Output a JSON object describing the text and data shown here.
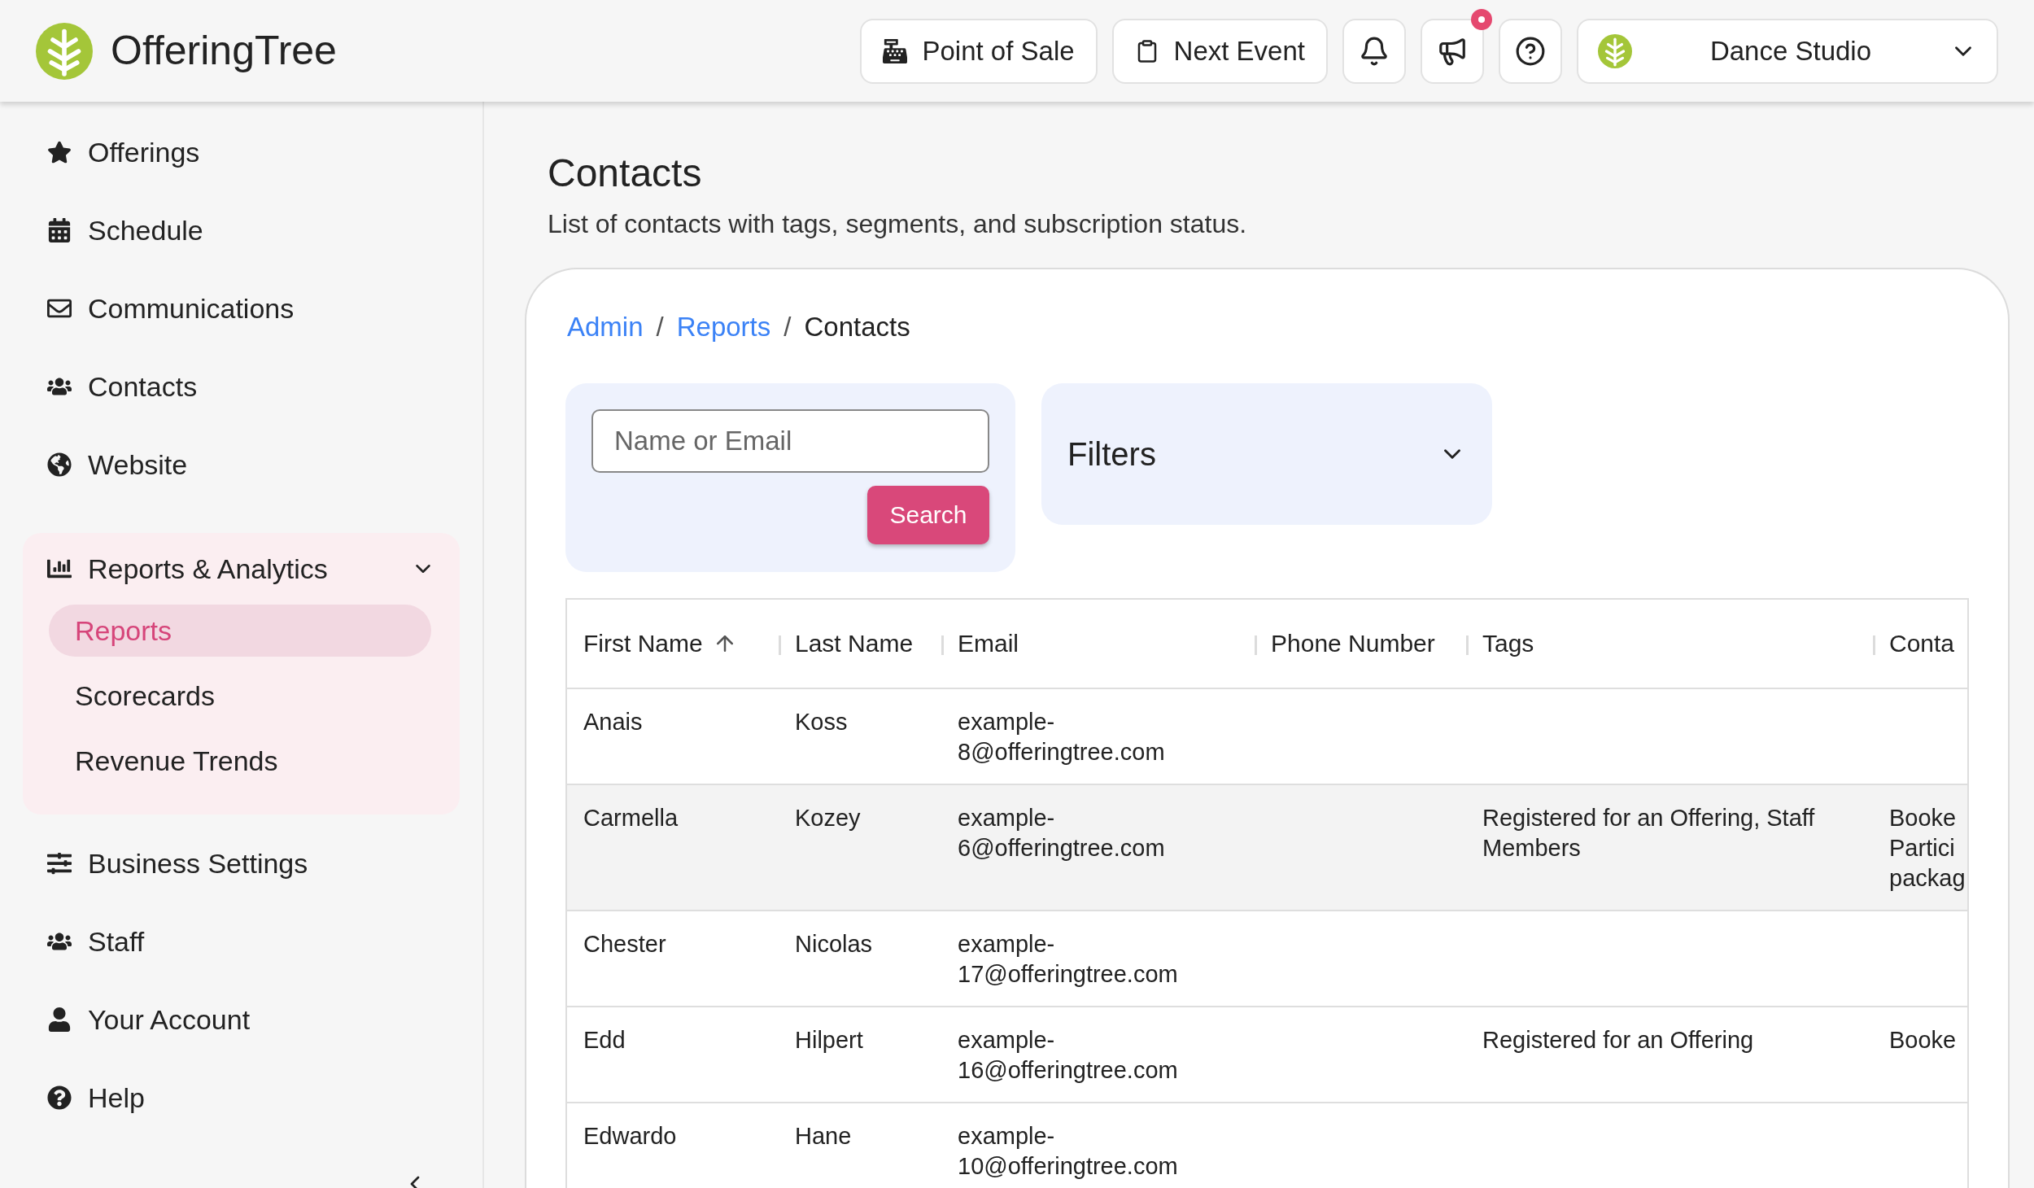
{
  "app": {
    "name": "OfferingTree"
  },
  "header_actions": [
    {
      "kind": "text",
      "label": "Point of Sale"
    },
    {
      "kind": "text",
      "label": "Next Event"
    },
    {
      "kind": "icon",
      "badge": false
    },
    {
      "kind": "icon",
      "badge": true
    },
    {
      "kind": "icon",
      "badge": false
    }
  ],
  "studio_switcher": {
    "label": "Dance Studio"
  },
  "sidebar": {
    "items": [
      {
        "kind": "link",
        "label": "Offerings"
      },
      {
        "kind": "link",
        "label": "Schedule"
      },
      {
        "kind": "link",
        "label": "Communications"
      },
      {
        "kind": "link",
        "label": "Contacts"
      },
      {
        "kind": "link",
        "label": "Website"
      },
      {
        "kind": "divider"
      },
      {
        "kind": "group",
        "label": "Reports & Analytics",
        "expanded": true,
        "children": [
          {
            "label": "Reports",
            "selected": true
          },
          {
            "label": "Scorecards",
            "selected": false
          },
          {
            "label": "Revenue Trends",
            "selected": false
          }
        ]
      },
      {
        "kind": "link",
        "label": "Business Settings"
      },
      {
        "kind": "link",
        "label": "Staff"
      },
      {
        "kind": "link",
        "label": "Your Account"
      },
      {
        "kind": "link",
        "label": "Help"
      },
      {
        "kind": "divider"
      }
    ]
  },
  "page": {
    "title": "Contacts",
    "subtitle": "List of contacts with tags, segments, and subscription status."
  },
  "breadcrumb": [
    {
      "label": "Admin",
      "kind": "link"
    },
    {
      "label": "/",
      "kind": "separator"
    },
    {
      "label": "Reports",
      "kind": "link"
    },
    {
      "label": "/",
      "kind": "separator"
    },
    {
      "label": "Contacts",
      "kind": "current"
    }
  ],
  "search": {
    "placeholder": "Name or Email",
    "button": "Search"
  },
  "filters": {
    "label": "Filters",
    "expanded": false
  },
  "table": {
    "columns": [
      {
        "label": "First Name",
        "sorted": true
      },
      {
        "label": "Last Name",
        "sorted": false
      },
      {
        "label": "Email",
        "sorted": false
      },
      {
        "label": "Phone Number",
        "sorted": false
      },
      {
        "label": "Tags",
        "sorted": false
      },
      {
        "label": "Conta",
        "sorted": false
      }
    ],
    "rows": [
      {
        "selected": false,
        "cells": [
          "Anais",
          "Koss",
          "example-8@offeringtree.com",
          "",
          "",
          ""
        ]
      },
      {
        "selected": true,
        "cells": [
          "Carmella",
          "Kozey",
          "example-6@offeringtree.com",
          "",
          "Registered for an Offering, Staff Members",
          "Booke Partici packag"
        ]
      },
      {
        "selected": false,
        "cells": [
          "Chester",
          "Nicolas",
          "example-17@offeringtree.com",
          "",
          "",
          ""
        ]
      },
      {
        "selected": false,
        "cells": [
          "Edd",
          "Hilpert",
          "example-16@offeringtree.com",
          "",
          "Registered for an Offering",
          "Booke"
        ]
      },
      {
        "selected": false,
        "cells": [
          "Edwardo",
          "Hane",
          "example-10@offeringtree.com",
          "",
          "",
          ""
        ]
      }
    ]
  }
}
